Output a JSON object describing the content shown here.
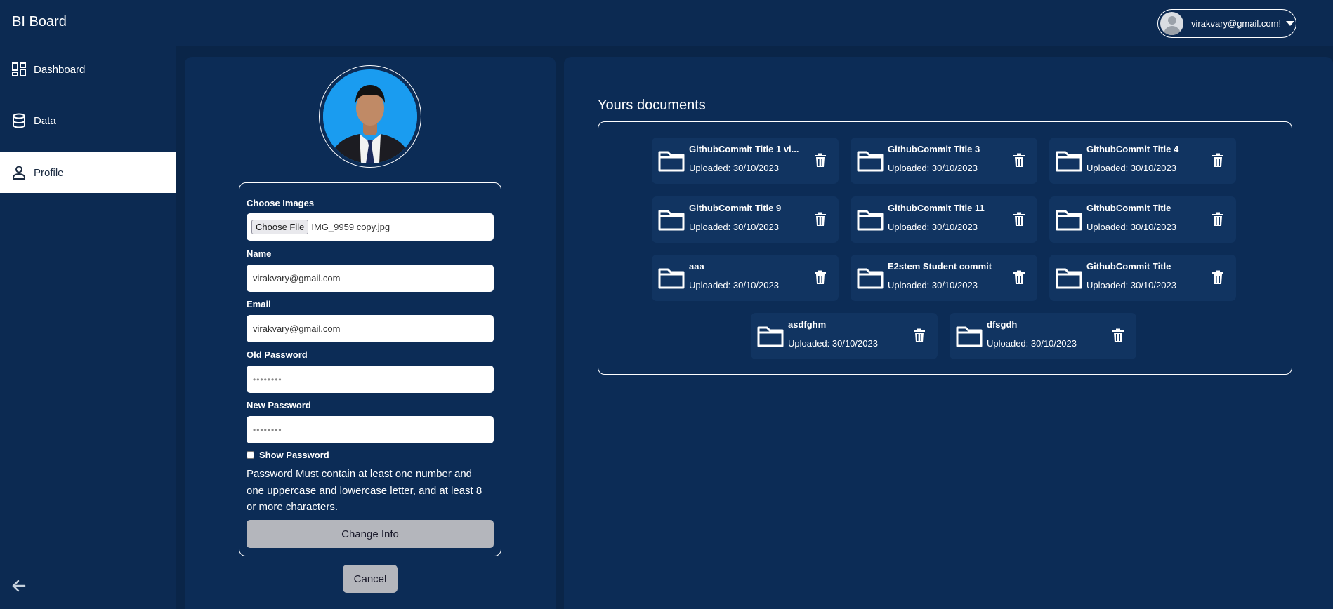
{
  "app": {
    "title": "BI Board"
  },
  "user": {
    "email": "virakvary@gmail.com!"
  },
  "sidebar": {
    "items": [
      {
        "label": "Dashboard",
        "icon": "dashboard-icon"
      },
      {
        "label": "Data",
        "icon": "database-icon"
      },
      {
        "label": "Profile",
        "icon": "person-icon",
        "active": true
      }
    ]
  },
  "profile": {
    "choose_images_label": "Choose Images",
    "file_button": "Choose File",
    "file_name": "IMG_9959 copy.jpg",
    "name_label": "Name",
    "name_value": "virakvary@gmail.com",
    "email_label": "Email",
    "email_value": "virakvary@gmail.com",
    "old_password_label": "Old Password",
    "old_password_value": "••••••••",
    "new_password_label": "New Password",
    "new_password_value": "••••••••",
    "show_password_label": "Show Password",
    "password_hint": "Password Must contain at least one number and one uppercase and lowercase letter, and at least 8 or more characters.",
    "change_button": "Change Info",
    "cancel_button": "Cancel"
  },
  "documents": {
    "title": "Yours documents",
    "items": [
      {
        "title": "GithubCommit Title 1 vi...",
        "date": "Uploaded: 30/10/2023"
      },
      {
        "title": "GithubCommit Title 3",
        "date": "Uploaded: 30/10/2023"
      },
      {
        "title": "GithubCommit Title 4",
        "date": "Uploaded: 30/10/2023"
      },
      {
        "title": "GithubCommit Title 9",
        "date": "Uploaded: 30/10/2023"
      },
      {
        "title": "GithubCommit Title 11",
        "date": "Uploaded: 30/10/2023"
      },
      {
        "title": "GithubCommit Title",
        "date": "Uploaded: 30/10/2023"
      },
      {
        "title": "aaa",
        "date": "Uploaded: 30/10/2023"
      },
      {
        "title": "E2stem Student commit",
        "date": "Uploaded: 30/10/2023"
      },
      {
        "title": "GithubCommit Title",
        "date": "Uploaded: 30/10/2023"
      },
      {
        "title": "asdfghm",
        "date": "Uploaded: 30/10/2023"
      },
      {
        "title": "dfsgdh",
        "date": "Uploaded: 30/10/2023"
      }
    ]
  },
  "colors": {
    "background": "#0a2a50",
    "panel": "#0c2c56",
    "doc_item": "#113461",
    "button_gray": "#b4b6bc",
    "avatar_bg": "#1a9cf0"
  }
}
